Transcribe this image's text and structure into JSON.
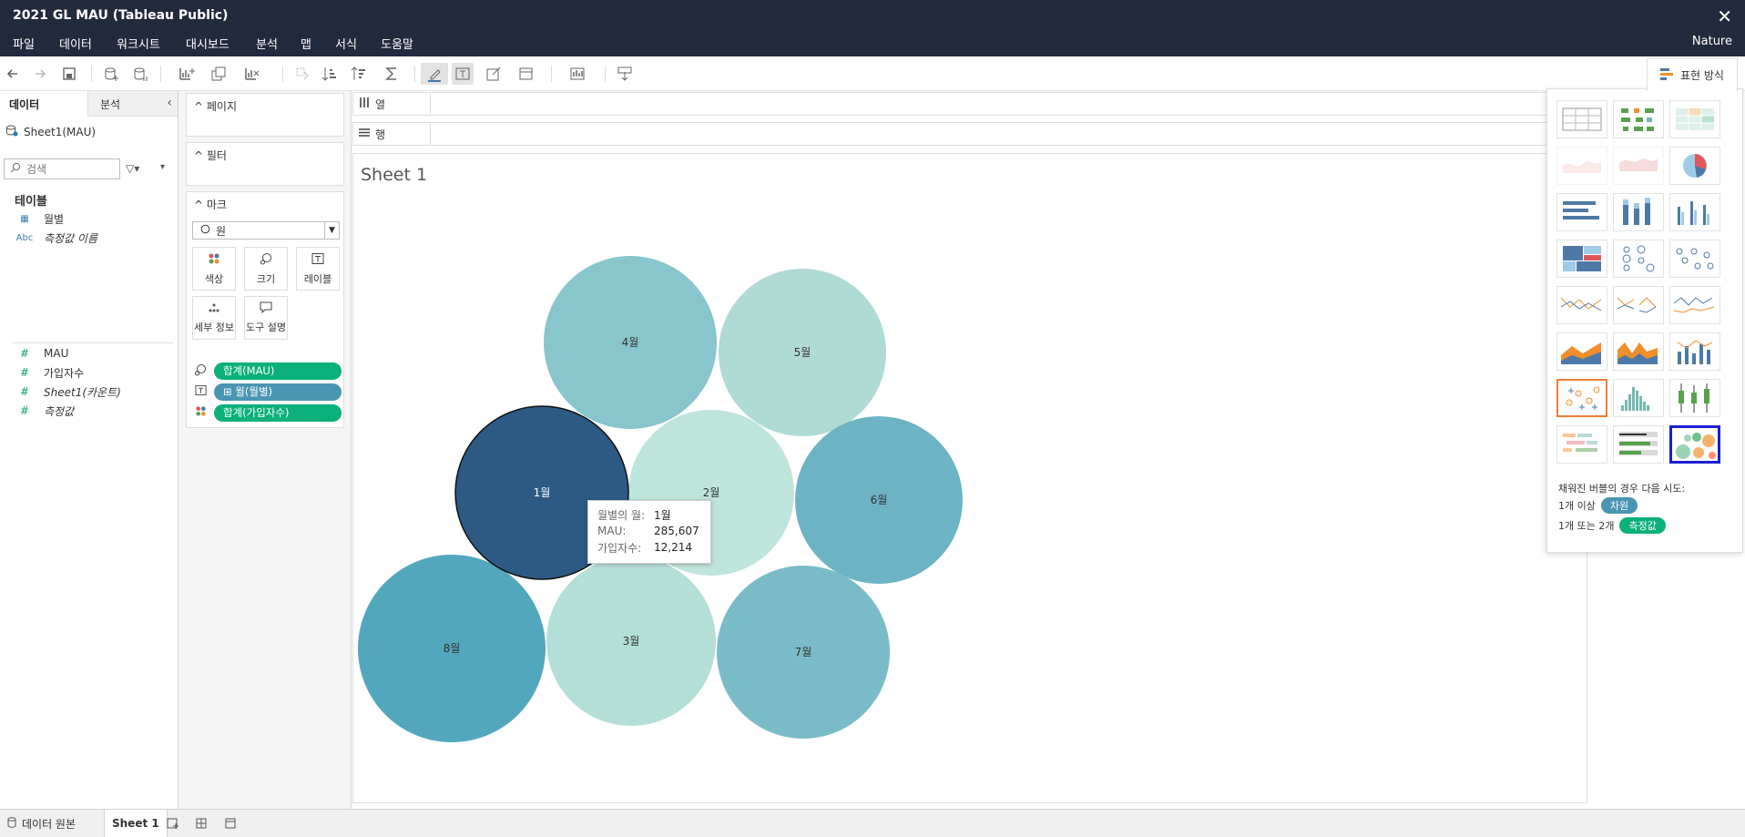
{
  "window": {
    "title": "2021 GL MAU (Tableau Public)",
    "close": "✕"
  },
  "menu": [
    "파일",
    "데이터",
    "워크시트",
    "대시보드",
    "분석",
    "맵",
    "서식",
    "도움말"
  ],
  "user": "Nature",
  "showme_button": "표현 방식",
  "data_pane": {
    "tabs": [
      "데이터",
      "분석"
    ],
    "collapse": "‹",
    "datasource": "Sheet1(MAU)",
    "search_placeholder": "검색",
    "filter_icon": "▽▾",
    "menu_icon": "▾",
    "tables_label": "테이블",
    "dimensions": [
      {
        "icon": "▦",
        "name": "월별",
        "italic": false
      },
      {
        "icon": "Abc",
        "name": "측정값 이름",
        "italic": true
      }
    ],
    "measures": [
      {
        "icon": "#",
        "name": "MAU",
        "italic": false
      },
      {
        "icon": "#",
        "name": "가입자수",
        "italic": false
      },
      {
        "icon": "#",
        "name": "Sheet1(카운트)",
        "italic": true
      },
      {
        "icon": "#",
        "name": "측정값",
        "italic": true
      }
    ]
  },
  "cards": {
    "pages": "페이지",
    "filters": "필터",
    "marks": "마크",
    "mark_type": "원",
    "buttons": [
      "색상",
      "크기",
      "레이블",
      "세부 정보",
      "도구 설명"
    ],
    "pills": [
      {
        "icon": "size",
        "label": "합계(MAU)",
        "color": "#0bb07b"
      },
      {
        "icon": "label",
        "label": "⊞ 월(월별)",
        "color": "#4996b2"
      },
      {
        "icon": "color",
        "label": "합계(가입자수)",
        "color": "#0bb07b"
      }
    ]
  },
  "shelves": {
    "columns": "열",
    "rows": "행"
  },
  "sheet_title": "Sheet 1",
  "chart_data": {
    "type": "packed-bubble",
    "encoding": {
      "size": "합계(MAU)",
      "color": "합계(가입자수)",
      "label": "월(월별)"
    },
    "bubbles": [
      {
        "label": "1월",
        "color": "#2d5a84",
        "selected": true
      },
      {
        "label": "2월",
        "color": "#bfe4db",
        "selected": false
      },
      {
        "label": "3월",
        "color": "#b4dfd6",
        "selected": false
      },
      {
        "label": "4월",
        "color": "#88c5cc",
        "selected": false
      },
      {
        "label": "5월",
        "color": "#afdbd4",
        "selected": false
      },
      {
        "label": "6월",
        "color": "#6cb4c3",
        "selected": false
      },
      {
        "label": "7월",
        "color": "#79bcc7",
        "selected": false
      },
      {
        "label": "8월",
        "color": "#53a7bd",
        "selected": false
      }
    ]
  },
  "tooltip": {
    "rows": [
      {
        "k": "월별의 월:",
        "v": "1월"
      },
      {
        "k": "MAU:",
        "v": "285,607"
      },
      {
        "k": "가입자수:",
        "v": "12,214"
      }
    ]
  },
  "showme": {
    "hint": "채워진 버블의 경우 다음 시도:",
    "req1_prefix": "1개 이상",
    "req1_pill": "차원",
    "req2_prefix": "1개 또는 2개",
    "req2_pill": "측정값",
    "colors": {
      "dim": "#4996b2",
      "measure": "#0bb07b"
    }
  },
  "bottom": {
    "datasource_tab": "데이터 원본",
    "sheet_tab": "Sheet 1"
  }
}
